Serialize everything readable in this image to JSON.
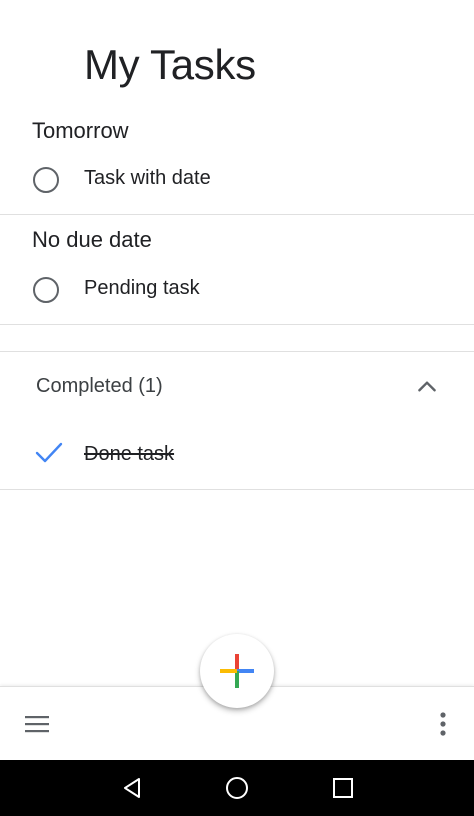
{
  "header": {
    "title": "My Tasks"
  },
  "sections": [
    {
      "title": "Tomorrow",
      "tasks": [
        {
          "label": "Task with date",
          "icon": "circle-outline-icon"
        }
      ]
    },
    {
      "title": "No due date",
      "tasks": [
        {
          "label": "Pending task",
          "icon": "circle-outline-icon"
        }
      ]
    }
  ],
  "completed": {
    "label": "Completed (1)",
    "expanded_icon": "chevron-up-icon",
    "tasks": [
      {
        "label": "Done task",
        "icon": "checkmark-icon"
      }
    ]
  },
  "bottom_bar": {
    "menu_icon": "hamburger-menu-icon",
    "more_icon": "more-vert-icon",
    "fab_icon": "plus-icon"
  },
  "nav_bar": {
    "back_icon": "back-triangle-icon",
    "home_icon": "home-circle-icon",
    "recents_icon": "recents-square-icon"
  },
  "colors": {
    "accent_blue": "#4285F4",
    "accent_red": "#EA4335",
    "accent_yellow": "#FBBC04",
    "accent_green": "#34A853",
    "text_primary": "#202124",
    "icon_gray": "#5f6368",
    "divider": "#e0e0e0",
    "nav_bar": "#000000"
  }
}
